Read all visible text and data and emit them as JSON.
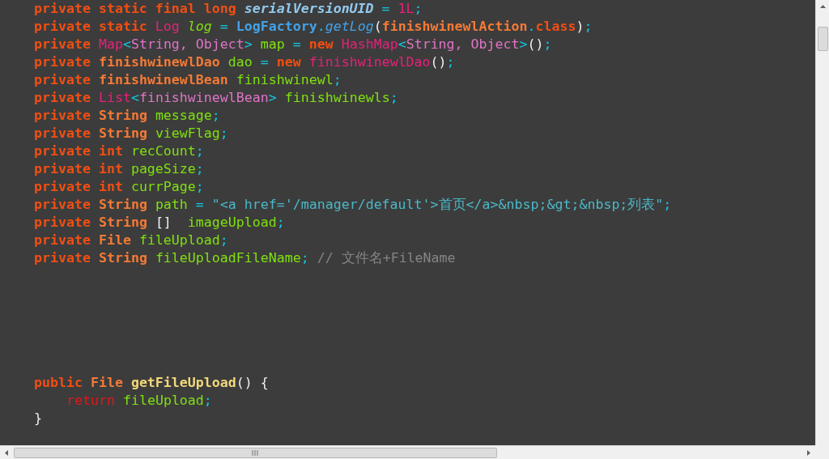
{
  "editor": {
    "lines": [
      {
        "kind": "code",
        "tokens": [
          {
            "kind": "kw",
            "text": "private static final long "
          },
          {
            "kind": "ital",
            "text": "serialVersionUID"
          },
          {
            "kind": "punct",
            "text": " = "
          },
          {
            "kind": "pink",
            "text": "1L"
          },
          {
            "kind": "punct",
            "text": ";"
          }
        ]
      },
      {
        "kind": "code",
        "tokens": [
          {
            "kind": "kw",
            "text": "private static "
          },
          {
            "kind": "pink",
            "text": "Log "
          },
          {
            "kind": "italg",
            "text": "log"
          },
          {
            "kind": "punct",
            "text": " = "
          },
          {
            "kind": "cls",
            "text": "LogFactory"
          },
          {
            "kind": "punct",
            "text": "."
          },
          {
            "kind": "meth",
            "text": "getLog"
          },
          {
            "kind": "plain",
            "text": "("
          },
          {
            "kind": "type",
            "text": "finishwinewlAction"
          },
          {
            "kind": "punct",
            "text": "."
          },
          {
            "kind": "kw",
            "text": "class"
          },
          {
            "kind": "plain",
            "text": ")"
          },
          {
            "kind": "punct",
            "text": ";"
          }
        ]
      },
      {
        "kind": "code",
        "tokens": [
          {
            "kind": "kw",
            "text": "private "
          },
          {
            "kind": "pink",
            "text": "Map"
          },
          {
            "kind": "punct",
            "text": "<"
          },
          {
            "kind": "gen",
            "text": "String, Object"
          },
          {
            "kind": "punct",
            "text": "> "
          },
          {
            "kind": "ident",
            "text": "map"
          },
          {
            "kind": "punct",
            "text": " = "
          },
          {
            "kind": "kw",
            "text": "new "
          },
          {
            "kind": "pink",
            "text": "HashMap"
          },
          {
            "kind": "punct",
            "text": "<"
          },
          {
            "kind": "gen",
            "text": "String, Object"
          },
          {
            "kind": "punct",
            "text": ">"
          },
          {
            "kind": "plain",
            "text": "()"
          },
          {
            "kind": "punct",
            "text": ";"
          }
        ]
      },
      {
        "kind": "code",
        "tokens": [
          {
            "kind": "kw",
            "text": "private "
          },
          {
            "kind": "type",
            "text": "finishwinewlDao "
          },
          {
            "kind": "ident",
            "text": "dao"
          },
          {
            "kind": "punct",
            "text": " = "
          },
          {
            "kind": "kw",
            "text": "new "
          },
          {
            "kind": "pink",
            "text": "finishwinewlDao"
          },
          {
            "kind": "plain",
            "text": "()"
          },
          {
            "kind": "punct",
            "text": ";"
          }
        ]
      },
      {
        "kind": "code",
        "tokens": [
          {
            "kind": "kw",
            "text": "private "
          },
          {
            "kind": "type",
            "text": "finishwinewlBean "
          },
          {
            "kind": "ident",
            "text": "finishwinewl"
          },
          {
            "kind": "punct",
            "text": ";"
          }
        ]
      },
      {
        "kind": "code",
        "tokens": [
          {
            "kind": "kw",
            "text": "private "
          },
          {
            "kind": "pink",
            "text": "List"
          },
          {
            "kind": "punct",
            "text": "<"
          },
          {
            "kind": "gen",
            "text": "finishwinewlBean"
          },
          {
            "kind": "punct",
            "text": "> "
          },
          {
            "kind": "ident",
            "text": "finishwinewls"
          },
          {
            "kind": "punct",
            "text": ";"
          }
        ]
      },
      {
        "kind": "code",
        "tokens": [
          {
            "kind": "kw",
            "text": "private "
          },
          {
            "kind": "type",
            "text": "String "
          },
          {
            "kind": "ident",
            "text": "message"
          },
          {
            "kind": "punct",
            "text": ";"
          }
        ]
      },
      {
        "kind": "code",
        "tokens": [
          {
            "kind": "kw",
            "text": "private "
          },
          {
            "kind": "type",
            "text": "String "
          },
          {
            "kind": "ident",
            "text": "viewFlag"
          },
          {
            "kind": "punct",
            "text": ";"
          }
        ]
      },
      {
        "kind": "code",
        "tokens": [
          {
            "kind": "kw",
            "text": "private int "
          },
          {
            "kind": "ident",
            "text": "recCount"
          },
          {
            "kind": "punct",
            "text": ";"
          }
        ]
      },
      {
        "kind": "code",
        "tokens": [
          {
            "kind": "kw",
            "text": "private int "
          },
          {
            "kind": "ident",
            "text": "pageSize"
          },
          {
            "kind": "punct",
            "text": ";"
          }
        ]
      },
      {
        "kind": "code",
        "tokens": [
          {
            "kind": "kw",
            "text": "private int "
          },
          {
            "kind": "ident",
            "text": "currPage"
          },
          {
            "kind": "punct",
            "text": ";"
          }
        ]
      },
      {
        "kind": "code",
        "tokens": [
          {
            "kind": "kw",
            "text": "private "
          },
          {
            "kind": "type",
            "text": "String "
          },
          {
            "kind": "ident",
            "text": "path"
          },
          {
            "kind": "punct",
            "text": " = "
          },
          {
            "kind": "str",
            "text": "\"<a href='/manager/default'>首页</a>&nbsp;&gt;&nbsp;列表\""
          },
          {
            "kind": "punct",
            "text": ";"
          }
        ]
      },
      {
        "kind": "code",
        "tokens": [
          {
            "kind": "kw",
            "text": "private "
          },
          {
            "kind": "type",
            "text": "String "
          },
          {
            "kind": "plain",
            "text": "[]  "
          },
          {
            "kind": "ident",
            "text": "imageUpload"
          },
          {
            "kind": "punct",
            "text": ";"
          }
        ]
      },
      {
        "kind": "code",
        "tokens": [
          {
            "kind": "kw",
            "text": "private "
          },
          {
            "kind": "type",
            "text": "File "
          },
          {
            "kind": "ident",
            "text": "fileUpload"
          },
          {
            "kind": "punct",
            "text": ";"
          }
        ]
      },
      {
        "kind": "code",
        "tokens": [
          {
            "kind": "kw",
            "text": "private "
          },
          {
            "kind": "type",
            "text": "String "
          },
          {
            "kind": "ident",
            "text": "fileUploadFileName"
          },
          {
            "kind": "punct",
            "text": "; "
          },
          {
            "kind": "com",
            "text": "// 文件名+FileName"
          }
        ]
      },
      {
        "kind": "blank"
      },
      {
        "kind": "blank"
      },
      {
        "kind": "blank"
      },
      {
        "kind": "blank"
      },
      {
        "kind": "blank"
      },
      {
        "kind": "blank"
      },
      {
        "kind": "code",
        "tokens": [
          {
            "kind": "kw",
            "text": "public "
          },
          {
            "kind": "type",
            "text": "File "
          },
          {
            "kind": "fn",
            "text": "getFileUpload"
          },
          {
            "kind": "plain",
            "text": "() {"
          }
        ],
        "children": [
          {
            "kind": "code",
            "tokens": [
              {
                "kind": "ret",
                "text": "return "
              },
              {
                "kind": "ident",
                "text": "fileUpload"
              },
              {
                "kind": "punct",
                "text": ";"
              }
            ]
          }
        ]
      },
      {
        "kind": "code",
        "tokens": [
          {
            "kind": "plain",
            "text": "}"
          }
        ]
      }
    ]
  }
}
